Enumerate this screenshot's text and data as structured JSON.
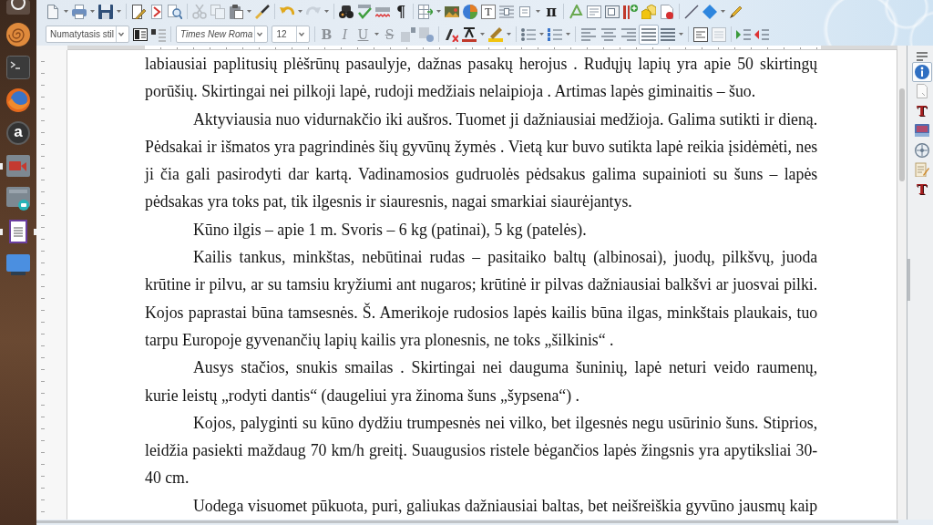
{
  "launcher": [
    {
      "running": false
    },
    {
      "running": false
    },
    {
      "running": false
    },
    {
      "running": false
    },
    {
      "glyph": "a",
      "running": false
    },
    {
      "running": true
    },
    {
      "running": false
    },
    {
      "running": true,
      "focused": true
    },
    {
      "running": false
    }
  ],
  "standard_toolbar": {
    "cut": {
      "disabled": true
    },
    "copy": {
      "disabled": true
    },
    "undo": {
      "disabled": false
    },
    "redo": {
      "disabled": true
    },
    "formatting_marks": "¶",
    "text_box": "T",
    "formula": "π"
  },
  "formatting_toolbar": {
    "paragraph_style": "Numatytasis stil",
    "font_name": "Times New Roma",
    "font_size": "12",
    "bold": "B",
    "italic": "I",
    "underline": "U",
    "strikethrough": "S",
    "alignment": [
      {
        "selected": false
      },
      {
        "selected": false
      },
      {
        "selected": false
      },
      {
        "selected": true
      }
    ]
  },
  "document": {
    "paragraphs": [
      {
        "text": "labiausiai paplitusių plėšrūnų pasaulyje, dažnas pasakų herojus . Rudųjų lapių yra apie 50 skirtingų porūšių. Skirtingai nei pilkoji lapė, rudoji medžiais nelaipioja . Artimas lapės giminaitis – šuo.",
        "indented": false,
        "continues": false
      },
      {
        "text": "Aktyviausia nuo vidurnakčio iki aušros. Tuomet ji dažniausiai medžioja. Galima sutikti ir dieną. Pėdsakai ir išmatos yra pagrindinės šių gyvūnų žymės . Vietą kur buvo sutikta lapė reikia įsidėmėti, nes ji čia gali pasirodyti dar kartą. Vadinamosios gudruolės pėdsakus galima supainioti su šuns – lapės pėdsakas yra toks pat, tik ilgesnis ir siauresnis, nagai smarkiai siaurėjantys.",
        "indented": true,
        "continues": false
      },
      {
        "text": "Kūno ilgis – apie 1 m. Svoris – 6 kg (patinai), 5 kg (patelės).",
        "indented": true,
        "continues": false
      },
      {
        "text": "Kailis tankus, minkštas, nebūtinai rudas – pasitaiko baltų (albinosai), juodų, pilkšvų, juoda krūtine ir pilvu, ar su tamsiu kryžiumi ant nugaros; krūtinė ir pilvas dažniausiai balkšvi ar juosvai pilki. Kojos paprastai būna tamsesnės. Š. Amerikoje rudosios lapės kailis būna ilgas, minkštais plaukais, tuo tarpu Europoje gyvenančių lapių kailis yra plonesnis, ne toks „šilkinis“ .",
        "indented": true,
        "continues": false
      },
      {
        "text": "Ausys stačios, snukis smailas . Skirtingai nei dauguma šuninių, lapė neturi veido raumenų, kurie leistų „rodyti dantis“ (daugeliui yra žinoma šuns „šypsena“) .",
        "indented": true,
        "continues": false
      },
      {
        "text": "Kojos, palyginti su kūno dydžiu trumpesnės nei vilko, bet ilgesnės negu usūrinio šuns. Stiprios, leidžia pasiekti maždaug 70 km/h greitį. Suaugusios ristele bėgančios lapės žingsnis yra apytiksliai 30-40 cm.",
        "indented": true,
        "continues": false
      },
      {
        "text": "Uodega visuomet pūkuota, puri, galiukas dažniausiai baltas, bet neišreiškia gyvūno jausmų kaip",
        "indented": true,
        "continues": true
      }
    ]
  },
  "sidebar": {
    "tabs": [
      {
        "selected": true
      },
      {
        "selected": false
      },
      {
        "glyph": "T",
        "selected": false
      },
      {
        "selected": false
      },
      {
        "selected": false
      },
      {
        "selected": false
      },
      {
        "glyph": "T",
        "selected": false
      }
    ]
  }
}
